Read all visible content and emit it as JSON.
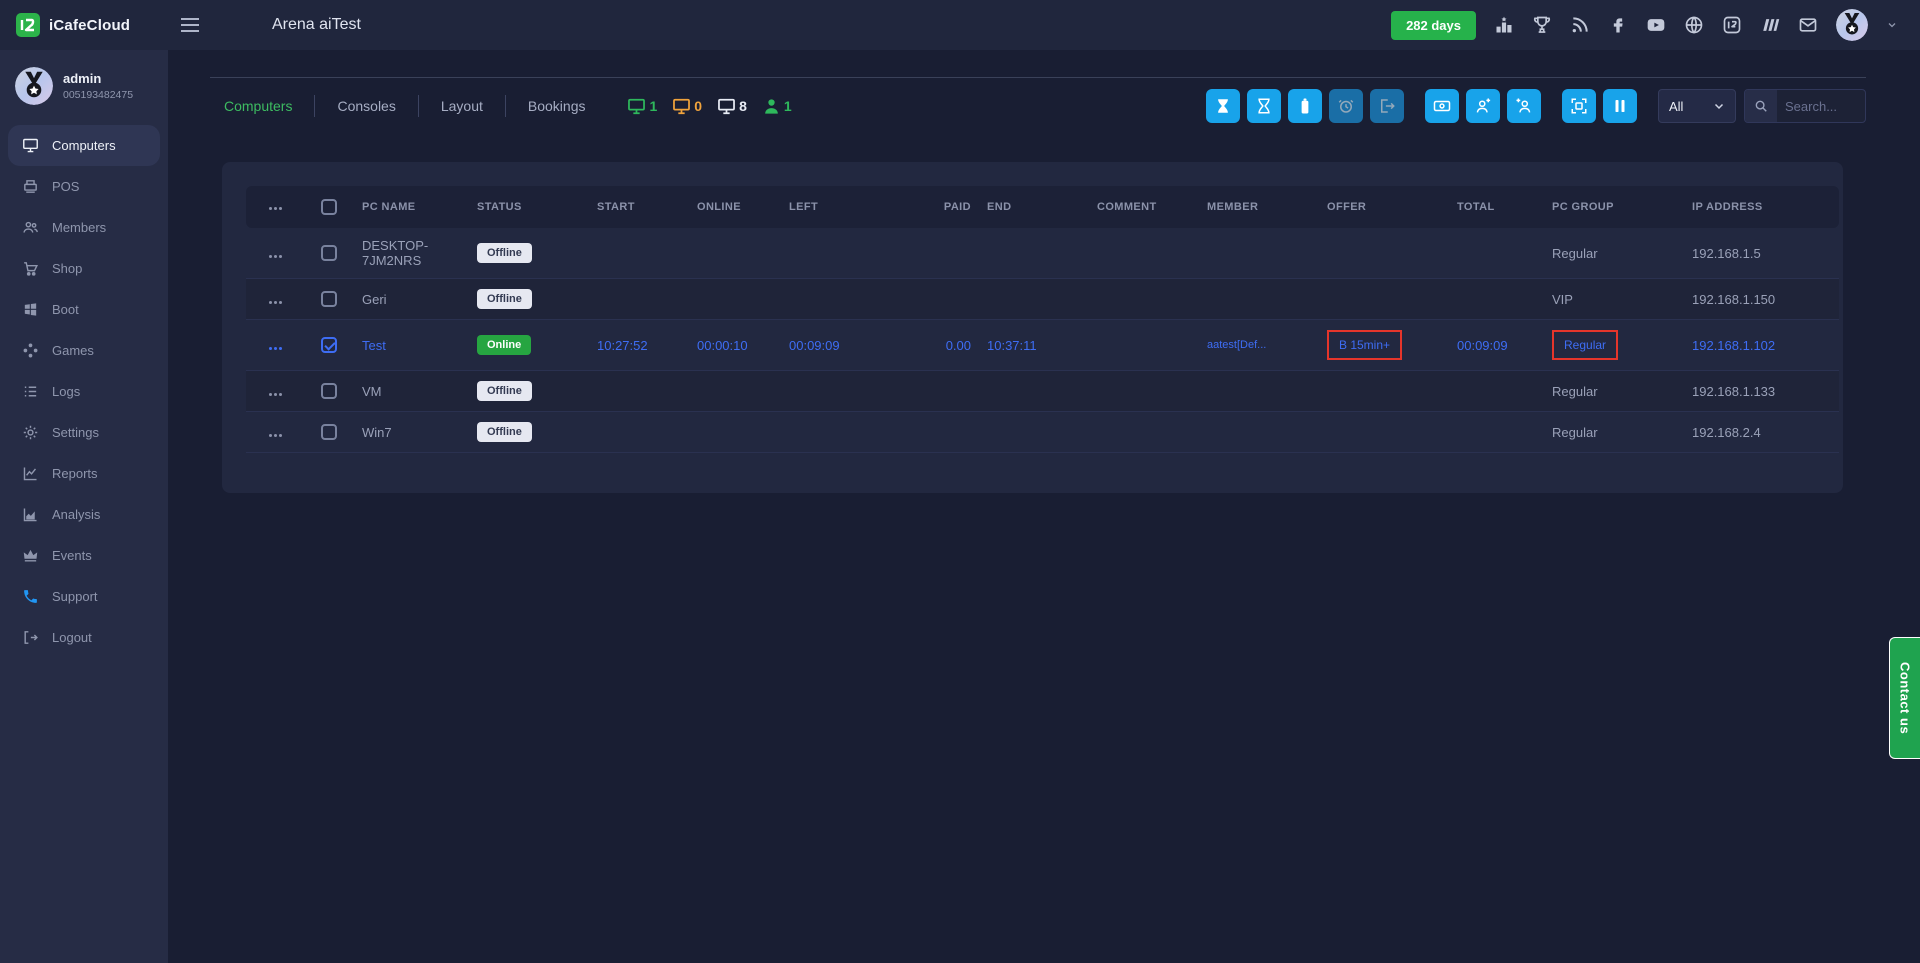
{
  "colors": {
    "accent_blue": "#18a3ea",
    "accent_blue_dim": "#1a6ea6",
    "link_blue": "#3e6df4",
    "green_badge": "#26b24b",
    "online_green": "#26a541",
    "tab_active_green": "#3dbb61",
    "red_outline": "#e5352b",
    "contact_green": "#1fa34f"
  },
  "header": {
    "logo_text": "iCafeCloud",
    "title": "Arena aiTest",
    "license_badge": "282 days"
  },
  "sidebar": {
    "user_name": "admin",
    "user_id": "005193482475",
    "items": [
      {
        "label": "Computers"
      },
      {
        "label": "POS"
      },
      {
        "label": "Members"
      },
      {
        "label": "Shop"
      },
      {
        "label": "Boot"
      },
      {
        "label": "Games"
      },
      {
        "label": "Logs"
      },
      {
        "label": "Settings"
      },
      {
        "label": "Reports"
      },
      {
        "label": "Analysis"
      },
      {
        "label": "Events"
      },
      {
        "label": "Support"
      },
      {
        "label": "Logout"
      }
    ]
  },
  "toolbar": {
    "tabs": [
      {
        "label": "Computers"
      },
      {
        "label": "Consoles"
      },
      {
        "label": "Layout"
      },
      {
        "label": "Bookings"
      }
    ],
    "counters": [
      {
        "name": "pcs-online",
        "value": "1",
        "color": "#2eb85c"
      },
      {
        "name": "pcs-idle",
        "value": "0",
        "color": "#f0a33c"
      },
      {
        "name": "pcs-total",
        "value": "8",
        "color": "#e8ecf5"
      },
      {
        "name": "members-online",
        "value": "1",
        "color": "#2eb85c"
      }
    ],
    "filter_value": "All",
    "search_placeholder": "Search..."
  },
  "table": {
    "headers": [
      "PC NAME",
      "STATUS",
      "START",
      "ONLINE",
      "LEFT",
      "PAID",
      "END",
      "COMMENT",
      "MEMBER",
      "OFFER",
      "TOTAL",
      "PC GROUP",
      "IP ADDRESS"
    ],
    "rows": [
      {
        "pc_name": "DESKTOP-7JM2NRS",
        "status": "Offline",
        "start": "",
        "online": "",
        "left": "",
        "paid": "",
        "end": "",
        "comment": "",
        "member": "",
        "offer": "",
        "total": "",
        "pc_group": "Regular",
        "ip": "192.168.1.5"
      },
      {
        "pc_name": "Geri",
        "status": "Offline",
        "start": "",
        "online": "",
        "left": "",
        "paid": "",
        "end": "",
        "comment": "",
        "member": "",
        "offer": "",
        "total": "",
        "pc_group": "VIP",
        "ip": "192.168.1.150"
      },
      {
        "pc_name": "Test",
        "status": "Online",
        "start": "10:27:52",
        "online": "00:00:10",
        "left": "00:09:09",
        "paid": "0.00",
        "end": "10:37:11",
        "comment": "",
        "member": "aatest[Def...",
        "offer": "B 15min+",
        "total": "00:09:09",
        "pc_group": "Regular",
        "ip": "192.168.1.102"
      },
      {
        "pc_name": "VM",
        "status": "Offline",
        "start": "",
        "online": "",
        "left": "",
        "paid": "",
        "end": "",
        "comment": "",
        "member": "",
        "offer": "",
        "total": "",
        "pc_group": "Regular",
        "ip": "192.168.1.133"
      },
      {
        "pc_name": "Win7",
        "status": "Offline",
        "start": "",
        "online": "",
        "left": "",
        "paid": "",
        "end": "",
        "comment": "",
        "member": "",
        "offer": "",
        "total": "",
        "pc_group": "Regular",
        "ip": "192.168.2.4"
      }
    ]
  },
  "contact": {
    "label": "Contact us"
  }
}
